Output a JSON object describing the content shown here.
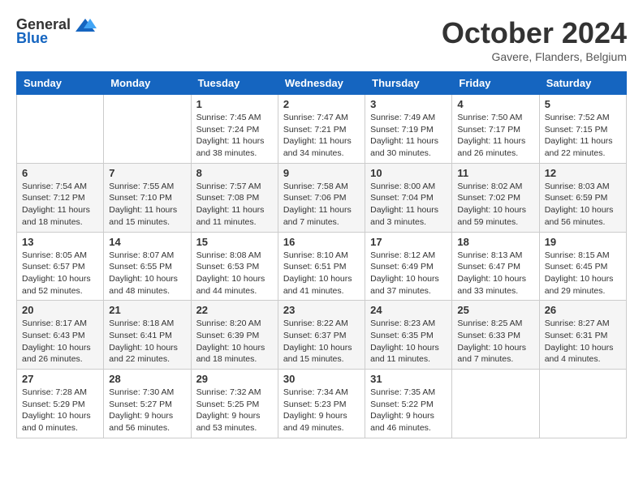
{
  "header": {
    "logo_general": "General",
    "logo_blue": "Blue",
    "month_title": "October 2024",
    "location": "Gavere, Flanders, Belgium"
  },
  "weekdays": [
    "Sunday",
    "Monday",
    "Tuesday",
    "Wednesday",
    "Thursday",
    "Friday",
    "Saturday"
  ],
  "weeks": [
    [
      {
        "day": "",
        "info": ""
      },
      {
        "day": "",
        "info": ""
      },
      {
        "day": "1",
        "info": "Sunrise: 7:45 AM\nSunset: 7:24 PM\nDaylight: 11 hours and 38 minutes."
      },
      {
        "day": "2",
        "info": "Sunrise: 7:47 AM\nSunset: 7:21 PM\nDaylight: 11 hours and 34 minutes."
      },
      {
        "day": "3",
        "info": "Sunrise: 7:49 AM\nSunset: 7:19 PM\nDaylight: 11 hours and 30 minutes."
      },
      {
        "day": "4",
        "info": "Sunrise: 7:50 AM\nSunset: 7:17 PM\nDaylight: 11 hours and 26 minutes."
      },
      {
        "day": "5",
        "info": "Sunrise: 7:52 AM\nSunset: 7:15 PM\nDaylight: 11 hours and 22 minutes."
      }
    ],
    [
      {
        "day": "6",
        "info": "Sunrise: 7:54 AM\nSunset: 7:12 PM\nDaylight: 11 hours and 18 minutes."
      },
      {
        "day": "7",
        "info": "Sunrise: 7:55 AM\nSunset: 7:10 PM\nDaylight: 11 hours and 15 minutes."
      },
      {
        "day": "8",
        "info": "Sunrise: 7:57 AM\nSunset: 7:08 PM\nDaylight: 11 hours and 11 minutes."
      },
      {
        "day": "9",
        "info": "Sunrise: 7:58 AM\nSunset: 7:06 PM\nDaylight: 11 hours and 7 minutes."
      },
      {
        "day": "10",
        "info": "Sunrise: 8:00 AM\nSunset: 7:04 PM\nDaylight: 11 hours and 3 minutes."
      },
      {
        "day": "11",
        "info": "Sunrise: 8:02 AM\nSunset: 7:02 PM\nDaylight: 10 hours and 59 minutes."
      },
      {
        "day": "12",
        "info": "Sunrise: 8:03 AM\nSunset: 6:59 PM\nDaylight: 10 hours and 56 minutes."
      }
    ],
    [
      {
        "day": "13",
        "info": "Sunrise: 8:05 AM\nSunset: 6:57 PM\nDaylight: 10 hours and 52 minutes."
      },
      {
        "day": "14",
        "info": "Sunrise: 8:07 AM\nSunset: 6:55 PM\nDaylight: 10 hours and 48 minutes."
      },
      {
        "day": "15",
        "info": "Sunrise: 8:08 AM\nSunset: 6:53 PM\nDaylight: 10 hours and 44 minutes."
      },
      {
        "day": "16",
        "info": "Sunrise: 8:10 AM\nSunset: 6:51 PM\nDaylight: 10 hours and 41 minutes."
      },
      {
        "day": "17",
        "info": "Sunrise: 8:12 AM\nSunset: 6:49 PM\nDaylight: 10 hours and 37 minutes."
      },
      {
        "day": "18",
        "info": "Sunrise: 8:13 AM\nSunset: 6:47 PM\nDaylight: 10 hours and 33 minutes."
      },
      {
        "day": "19",
        "info": "Sunrise: 8:15 AM\nSunset: 6:45 PM\nDaylight: 10 hours and 29 minutes."
      }
    ],
    [
      {
        "day": "20",
        "info": "Sunrise: 8:17 AM\nSunset: 6:43 PM\nDaylight: 10 hours and 26 minutes."
      },
      {
        "day": "21",
        "info": "Sunrise: 8:18 AM\nSunset: 6:41 PM\nDaylight: 10 hours and 22 minutes."
      },
      {
        "day": "22",
        "info": "Sunrise: 8:20 AM\nSunset: 6:39 PM\nDaylight: 10 hours and 18 minutes."
      },
      {
        "day": "23",
        "info": "Sunrise: 8:22 AM\nSunset: 6:37 PM\nDaylight: 10 hours and 15 minutes."
      },
      {
        "day": "24",
        "info": "Sunrise: 8:23 AM\nSunset: 6:35 PM\nDaylight: 10 hours and 11 minutes."
      },
      {
        "day": "25",
        "info": "Sunrise: 8:25 AM\nSunset: 6:33 PM\nDaylight: 10 hours and 7 minutes."
      },
      {
        "day": "26",
        "info": "Sunrise: 8:27 AM\nSunset: 6:31 PM\nDaylight: 10 hours and 4 minutes."
      }
    ],
    [
      {
        "day": "27",
        "info": "Sunrise: 7:28 AM\nSunset: 5:29 PM\nDaylight: 10 hours and 0 minutes."
      },
      {
        "day": "28",
        "info": "Sunrise: 7:30 AM\nSunset: 5:27 PM\nDaylight: 9 hours and 56 minutes."
      },
      {
        "day": "29",
        "info": "Sunrise: 7:32 AM\nSunset: 5:25 PM\nDaylight: 9 hours and 53 minutes."
      },
      {
        "day": "30",
        "info": "Sunrise: 7:34 AM\nSunset: 5:23 PM\nDaylight: 9 hours and 49 minutes."
      },
      {
        "day": "31",
        "info": "Sunrise: 7:35 AM\nSunset: 5:22 PM\nDaylight: 9 hours and 46 minutes."
      },
      {
        "day": "",
        "info": ""
      },
      {
        "day": "",
        "info": ""
      }
    ]
  ]
}
